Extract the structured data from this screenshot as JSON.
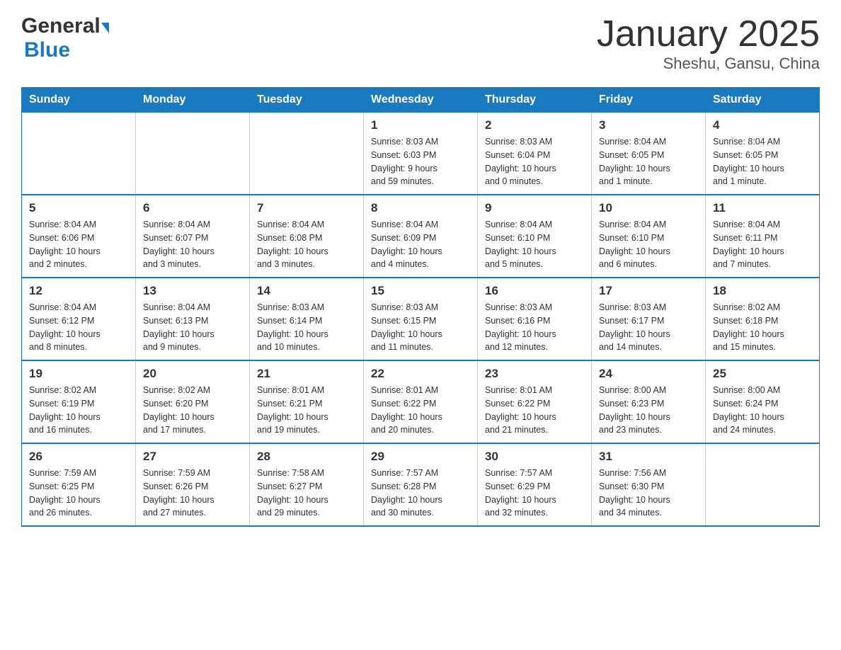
{
  "header": {
    "logo_general": "General",
    "logo_blue": "Blue",
    "title": "January 2025",
    "subtitle": "Sheshu, Gansu, China"
  },
  "days_of_week": [
    "Sunday",
    "Monday",
    "Tuesday",
    "Wednesday",
    "Thursday",
    "Friday",
    "Saturday"
  ],
  "weeks": [
    [
      {
        "day": "",
        "info": ""
      },
      {
        "day": "",
        "info": ""
      },
      {
        "day": "",
        "info": ""
      },
      {
        "day": "1",
        "info": "Sunrise: 8:03 AM\nSunset: 6:03 PM\nDaylight: 9 hours\nand 59 minutes."
      },
      {
        "day": "2",
        "info": "Sunrise: 8:03 AM\nSunset: 6:04 PM\nDaylight: 10 hours\nand 0 minutes."
      },
      {
        "day": "3",
        "info": "Sunrise: 8:04 AM\nSunset: 6:05 PM\nDaylight: 10 hours\nand 1 minute."
      },
      {
        "day": "4",
        "info": "Sunrise: 8:04 AM\nSunset: 6:05 PM\nDaylight: 10 hours\nand 1 minute."
      }
    ],
    [
      {
        "day": "5",
        "info": "Sunrise: 8:04 AM\nSunset: 6:06 PM\nDaylight: 10 hours\nand 2 minutes."
      },
      {
        "day": "6",
        "info": "Sunrise: 8:04 AM\nSunset: 6:07 PM\nDaylight: 10 hours\nand 3 minutes."
      },
      {
        "day": "7",
        "info": "Sunrise: 8:04 AM\nSunset: 6:08 PM\nDaylight: 10 hours\nand 3 minutes."
      },
      {
        "day": "8",
        "info": "Sunrise: 8:04 AM\nSunset: 6:09 PM\nDaylight: 10 hours\nand 4 minutes."
      },
      {
        "day": "9",
        "info": "Sunrise: 8:04 AM\nSunset: 6:10 PM\nDaylight: 10 hours\nand 5 minutes."
      },
      {
        "day": "10",
        "info": "Sunrise: 8:04 AM\nSunset: 6:10 PM\nDaylight: 10 hours\nand 6 minutes."
      },
      {
        "day": "11",
        "info": "Sunrise: 8:04 AM\nSunset: 6:11 PM\nDaylight: 10 hours\nand 7 minutes."
      }
    ],
    [
      {
        "day": "12",
        "info": "Sunrise: 8:04 AM\nSunset: 6:12 PM\nDaylight: 10 hours\nand 8 minutes."
      },
      {
        "day": "13",
        "info": "Sunrise: 8:04 AM\nSunset: 6:13 PM\nDaylight: 10 hours\nand 9 minutes."
      },
      {
        "day": "14",
        "info": "Sunrise: 8:03 AM\nSunset: 6:14 PM\nDaylight: 10 hours\nand 10 minutes."
      },
      {
        "day": "15",
        "info": "Sunrise: 8:03 AM\nSunset: 6:15 PM\nDaylight: 10 hours\nand 11 minutes."
      },
      {
        "day": "16",
        "info": "Sunrise: 8:03 AM\nSunset: 6:16 PM\nDaylight: 10 hours\nand 12 minutes."
      },
      {
        "day": "17",
        "info": "Sunrise: 8:03 AM\nSunset: 6:17 PM\nDaylight: 10 hours\nand 14 minutes."
      },
      {
        "day": "18",
        "info": "Sunrise: 8:02 AM\nSunset: 6:18 PM\nDaylight: 10 hours\nand 15 minutes."
      }
    ],
    [
      {
        "day": "19",
        "info": "Sunrise: 8:02 AM\nSunset: 6:19 PM\nDaylight: 10 hours\nand 16 minutes."
      },
      {
        "day": "20",
        "info": "Sunrise: 8:02 AM\nSunset: 6:20 PM\nDaylight: 10 hours\nand 17 minutes."
      },
      {
        "day": "21",
        "info": "Sunrise: 8:01 AM\nSunset: 6:21 PM\nDaylight: 10 hours\nand 19 minutes."
      },
      {
        "day": "22",
        "info": "Sunrise: 8:01 AM\nSunset: 6:22 PM\nDaylight: 10 hours\nand 20 minutes."
      },
      {
        "day": "23",
        "info": "Sunrise: 8:01 AM\nSunset: 6:22 PM\nDaylight: 10 hours\nand 21 minutes."
      },
      {
        "day": "24",
        "info": "Sunrise: 8:00 AM\nSunset: 6:23 PM\nDaylight: 10 hours\nand 23 minutes."
      },
      {
        "day": "25",
        "info": "Sunrise: 8:00 AM\nSunset: 6:24 PM\nDaylight: 10 hours\nand 24 minutes."
      }
    ],
    [
      {
        "day": "26",
        "info": "Sunrise: 7:59 AM\nSunset: 6:25 PM\nDaylight: 10 hours\nand 26 minutes."
      },
      {
        "day": "27",
        "info": "Sunrise: 7:59 AM\nSunset: 6:26 PM\nDaylight: 10 hours\nand 27 minutes."
      },
      {
        "day": "28",
        "info": "Sunrise: 7:58 AM\nSunset: 6:27 PM\nDaylight: 10 hours\nand 29 minutes."
      },
      {
        "day": "29",
        "info": "Sunrise: 7:57 AM\nSunset: 6:28 PM\nDaylight: 10 hours\nand 30 minutes."
      },
      {
        "day": "30",
        "info": "Sunrise: 7:57 AM\nSunset: 6:29 PM\nDaylight: 10 hours\nand 32 minutes."
      },
      {
        "day": "31",
        "info": "Sunrise: 7:56 AM\nSunset: 6:30 PM\nDaylight: 10 hours\nand 34 minutes."
      },
      {
        "day": "",
        "info": ""
      }
    ]
  ]
}
